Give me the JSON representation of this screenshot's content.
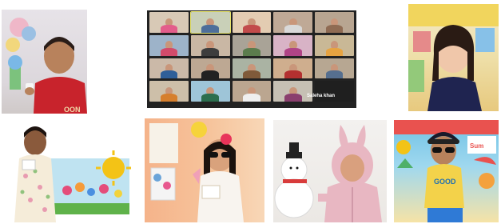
{
  "collage": {
    "photos": [
      {
        "id": "p1",
        "subject": "boy in red shirt holding a small card"
      },
      {
        "id": "p2",
        "subject": "online class video call grid"
      },
      {
        "id": "p3",
        "subject": "girl in navy dress smiling"
      },
      {
        "id": "p4",
        "subject": "girl in floral dress with sun and flowers artwork"
      },
      {
        "id": "p5",
        "subject": "girl with sunglasses and headband"
      },
      {
        "id": "p6",
        "subject": "child in pink bunny hoodie with snowman artwork"
      },
      {
        "id": "p7",
        "subject": "boy with sunglasses and summer decorations"
      }
    ],
    "video_call": {
      "participant_name": "Saleha khan"
    }
  },
  "colors": {
    "red_shirt": "#c8232c",
    "navy_dress": "#1f2450",
    "pink_hoodie": "#e8b7c2",
    "yellow_shirt": "#f3d24a",
    "sun_yellow": "#f3c316"
  }
}
